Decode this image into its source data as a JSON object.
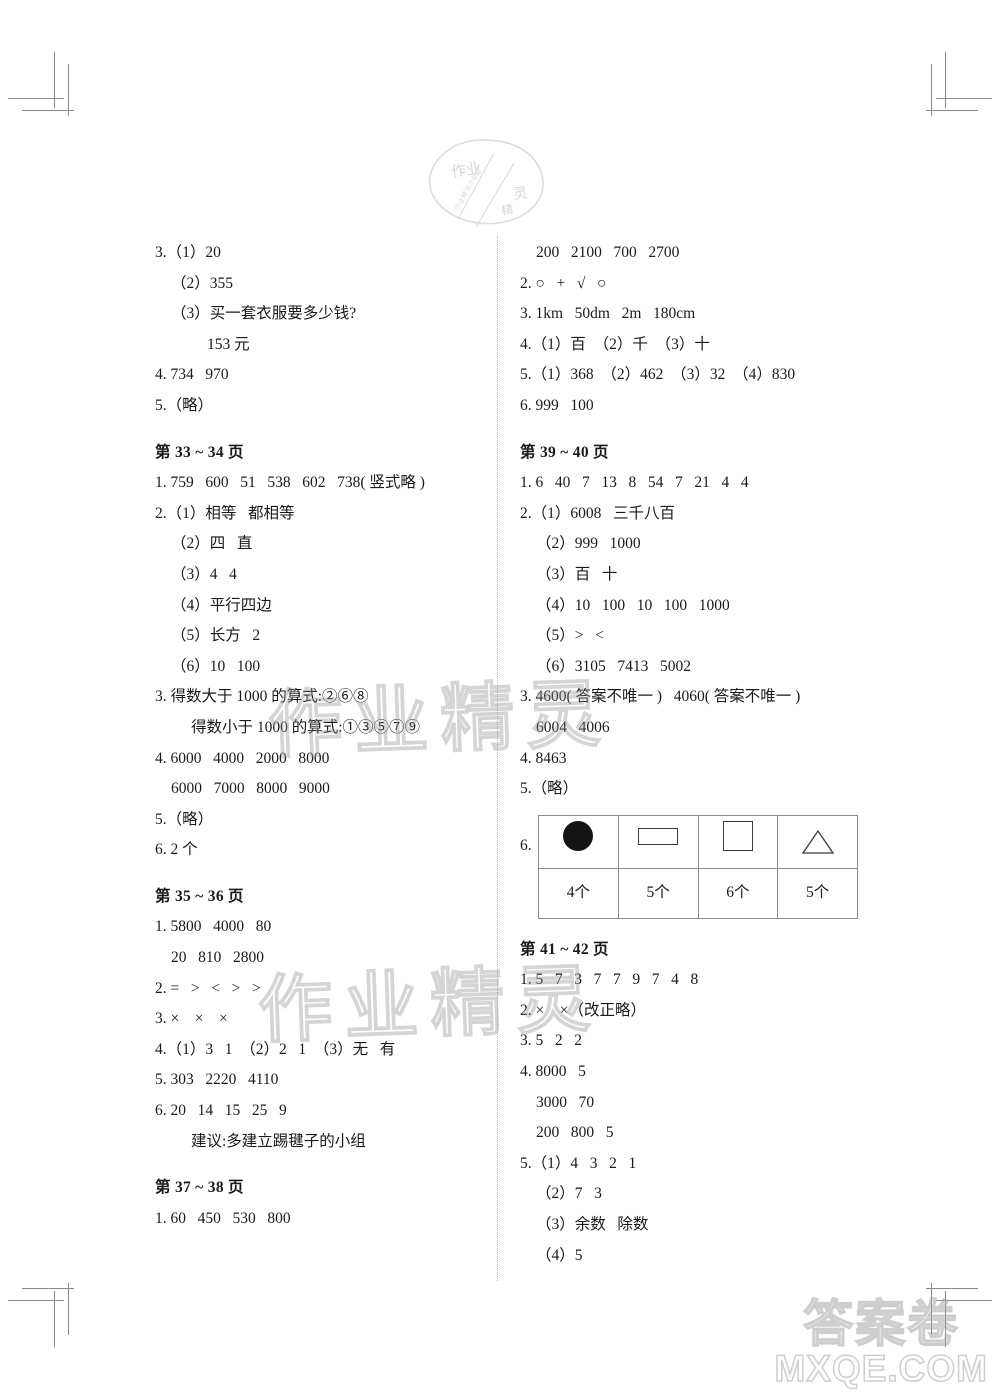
{
  "document": {
    "type": "answer-key-page",
    "top_seal_label": "作业帮精灵印章"
  },
  "watermarks": {
    "body_1": "作业精灵",
    "body_2": "作业精灵",
    "corner_cn": "答案卷",
    "corner_domain": "MXQE.COM"
  },
  "left_column": {
    "blocks": [
      {
        "lines": [
          {
            "indent": 0,
            "text": "3.（1）20"
          },
          {
            "indent": 1,
            "text": "（2）355"
          },
          {
            "indent": 1,
            "text": "（3）买一套衣服要多少钱?"
          },
          {
            "indent": 3,
            "text": "153 元"
          },
          {
            "indent": 0,
            "text": "4. 734   970"
          },
          {
            "indent": 0,
            "text": "5.（略）"
          }
        ]
      },
      {
        "heading": "第 33 ~ 34 页",
        "lines": [
          {
            "indent": 0,
            "text": "1. 759   600   51   538   602   738( 竖式略 )"
          },
          {
            "indent": 0,
            "text": "2.（1）相等   都相等"
          },
          {
            "indent": 1,
            "text": "（2）四   直"
          },
          {
            "indent": 1,
            "text": "（3）4   4"
          },
          {
            "indent": 1,
            "text": "（4）平行四边"
          },
          {
            "indent": 1,
            "text": "（5）长方   2"
          },
          {
            "indent": 1,
            "text": "（6）10   100"
          },
          {
            "indent": 0,
            "text": "3. 得数大于 1000 的算式:②⑥⑧"
          },
          {
            "indent": 2,
            "text": "得数小于 1000 的算式:①③⑤⑦⑨"
          },
          {
            "indent": 0,
            "text": "4. 6000   4000   2000   8000"
          },
          {
            "indent": 1,
            "text": "6000   7000   8000   9000"
          },
          {
            "indent": 0,
            "text": "5.（略）"
          },
          {
            "indent": 0,
            "text": "6. 2 个"
          }
        ]
      },
      {
        "heading": "第 35 ~ 36 页",
        "lines": [
          {
            "indent": 0,
            "text": "1. 5800   4000   80"
          },
          {
            "indent": 1,
            "text": "20   810   2800"
          },
          {
            "indent": 0,
            "text": "2. =   >   <   >   >"
          },
          {
            "indent": 0,
            "text": "3. ×    ×    ×"
          },
          {
            "indent": 0,
            "text": "4.（1）3   1  （2）2   1  （3）无   有"
          },
          {
            "indent": 0,
            "text": "5. 303   2220   4110"
          },
          {
            "indent": 0,
            "text": "6. 20   14   15   25   9"
          },
          {
            "indent": 2,
            "text": "建议:多建立踢毽子的小组"
          }
        ]
      },
      {
        "heading": "第 37 ~ 38 页",
        "lines": [
          {
            "indent": 0,
            "text": "1. 60   450   530   800"
          }
        ]
      }
    ]
  },
  "right_column": {
    "blocks": [
      {
        "lines": [
          {
            "indent": 1,
            "text": "200   2100   700   2700"
          },
          {
            "indent": 0,
            "text": "2. ○   +   √   ○"
          },
          {
            "indent": 0,
            "text": "3. 1km   50dm   2m   180cm"
          },
          {
            "indent": 0,
            "text": "4.（1）百  （2）千  （3）十"
          },
          {
            "indent": 0,
            "text": "5.（1）368  （2）462  （3）32  （4）830"
          },
          {
            "indent": 0,
            "text": "6. 999   100"
          }
        ]
      },
      {
        "heading": "第 39 ~ 40 页",
        "lines": [
          {
            "indent": 0,
            "text": "1. 6   40   7   13   8   54   7   21   4   4"
          },
          {
            "indent": 0,
            "text": "2.（1）6008   三千八百"
          },
          {
            "indent": 1,
            "text": "（2）999   1000"
          },
          {
            "indent": 1,
            "text": "（3）百   十"
          },
          {
            "indent": 1,
            "text": "（4）10   100   10   100   1000"
          },
          {
            "indent": 1,
            "text": "（5）>   <"
          },
          {
            "indent": 1,
            "text": "（6）3105   7413   5002"
          },
          {
            "indent": 0,
            "text": "3. 4600( 答案不唯一 )   4060( 答案不唯一 )"
          },
          {
            "indent": 1,
            "text": "6004   4006"
          },
          {
            "indent": 0,
            "text": "4. 8463"
          },
          {
            "indent": 0,
            "text": "5.（略）"
          }
        ],
        "shape_table": {
          "number_label": "6.",
          "shapes": [
            "filled-circle",
            "rectangle",
            "square",
            "triangle"
          ],
          "counts": [
            "4个",
            "5个",
            "6个",
            "5个"
          ]
        }
      },
      {
        "heading": "第 41 ~ 42 页",
        "lines": [
          {
            "indent": 0,
            "text": "1. 5   7   3   7   7   9   7   4   8"
          },
          {
            "indent": 0,
            "text": "2. ×    ×（改正略）"
          },
          {
            "indent": 0,
            "text": "3. 5   2   2"
          },
          {
            "indent": 0,
            "text": "4. 8000   5"
          },
          {
            "indent": 1,
            "text": "3000   70"
          },
          {
            "indent": 1,
            "text": "200   800   5"
          },
          {
            "indent": 0,
            "text": "5.（1）4   3   2   1"
          },
          {
            "indent": 1,
            "text": "（2）7   3"
          },
          {
            "indent": 1,
            "text": "（3）余数   除数"
          },
          {
            "indent": 1,
            "text": "（4）5"
          }
        ]
      }
    ]
  }
}
